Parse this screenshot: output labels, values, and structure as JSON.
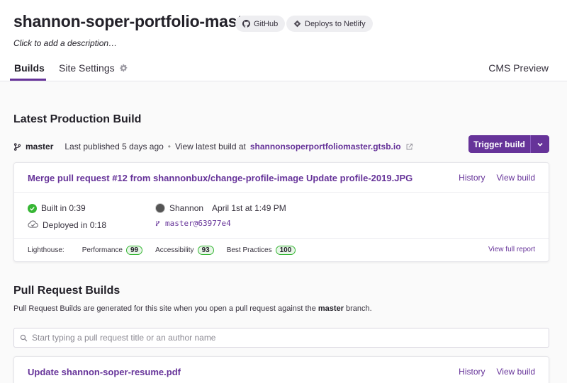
{
  "site": {
    "title": "shannon-soper-portfolio-master",
    "github_label": "GitHub",
    "netlify_label": "Deploys to Netlify",
    "description": "Click to add a description…"
  },
  "tabs": {
    "builds": "Builds",
    "settings": "Site Settings",
    "cms": "CMS Preview"
  },
  "latest": {
    "title": "Latest Production Build",
    "branch": "master",
    "published": "Last published 5 days ago",
    "separator": "•",
    "view_label": "View latest build at",
    "url": "shannonsoperportfoliomaster.gtsb.io",
    "trigger_label": "Trigger build",
    "card": {
      "title": "Merge pull request #12 from shannonbux/change-profile-image Update profile-2019.JPG",
      "history": "History",
      "view_build": "View build",
      "built": "Built in 0:39",
      "deployed": "Deployed in 0:18",
      "author": "Shannon",
      "time": "April 1st at 1:49 PM",
      "commit": "master@63977e4",
      "lighthouse_label": "Lighthouse:",
      "metrics": [
        {
          "name": "Performance",
          "score": "99"
        },
        {
          "name": "Accessibility",
          "score": "93"
        },
        {
          "name": "Best Practices",
          "score": "100"
        }
      ],
      "report": "View full report"
    }
  },
  "pr": {
    "title": "Pull Request Builds",
    "desc_pre": "Pull Request Builds are generated for this site when you open a pull request against the",
    "desc_branch": "master",
    "desc_post": "branch.",
    "search_placeholder": "Start typing a pull request title or an author name",
    "card": {
      "title": "Update shannon-soper-resume.pdf",
      "history": "History",
      "view_build": "View build"
    }
  },
  "colors": {
    "accent": "#663399",
    "success": "#37b635"
  }
}
